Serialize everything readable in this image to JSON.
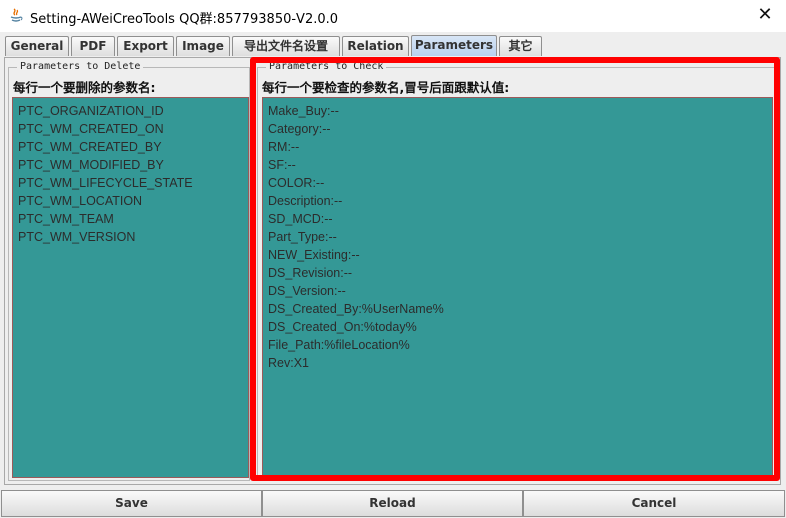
{
  "window": {
    "title": "Setting-AWeiCreoTools QQ群:857793850-V2.0.0",
    "close_label": "✕"
  },
  "tabs": [
    {
      "label": "General"
    },
    {
      "label": "PDF"
    },
    {
      "label": "Export"
    },
    {
      "label": "Image"
    },
    {
      "label": "导出文件名设置"
    },
    {
      "label": "Relation"
    },
    {
      "label": "Parameters",
      "active": true
    },
    {
      "label": "其它"
    }
  ],
  "left_panel": {
    "legend": "Parameters to Delete",
    "hint": "每行一个要删除的参数名:",
    "lines": [
      "PTC_ORGANIZATION_ID",
      "PTC_WM_CREATED_ON",
      "PTC_WM_CREATED_BY",
      "PTC_WM_MODIFIED_BY",
      "PTC_WM_LIFECYCLE_STATE",
      "PTC_WM_LOCATION",
      "PTC_WM_TEAM",
      "PTC_WM_VERSION"
    ]
  },
  "right_panel": {
    "legend": "Parameters to Check",
    "hint": "每行一个要检查的参数名,冒号后面跟默认值:",
    "lines": [
      "Make_Buy:--",
      "Category:--",
      "RM:--",
      "SF:--",
      "COLOR:--",
      "Description:--",
      "SD_MCD:--",
      "Part_Type:--",
      "NEW_Existing:--",
      "DS_Revision:--",
      "DS_Version:--",
      "DS_Created_By:%UserName%",
      "DS_Created_On:%today%",
      "File_Path:%fileLocation%",
      "Rev:X1"
    ]
  },
  "buttons": {
    "save": "Save",
    "reload": "Reload",
    "cancel": "Cancel"
  },
  "colors": {
    "textarea_bg": "#349896",
    "highlight": "#ff0000",
    "active_tab": "#b8d0ee"
  }
}
